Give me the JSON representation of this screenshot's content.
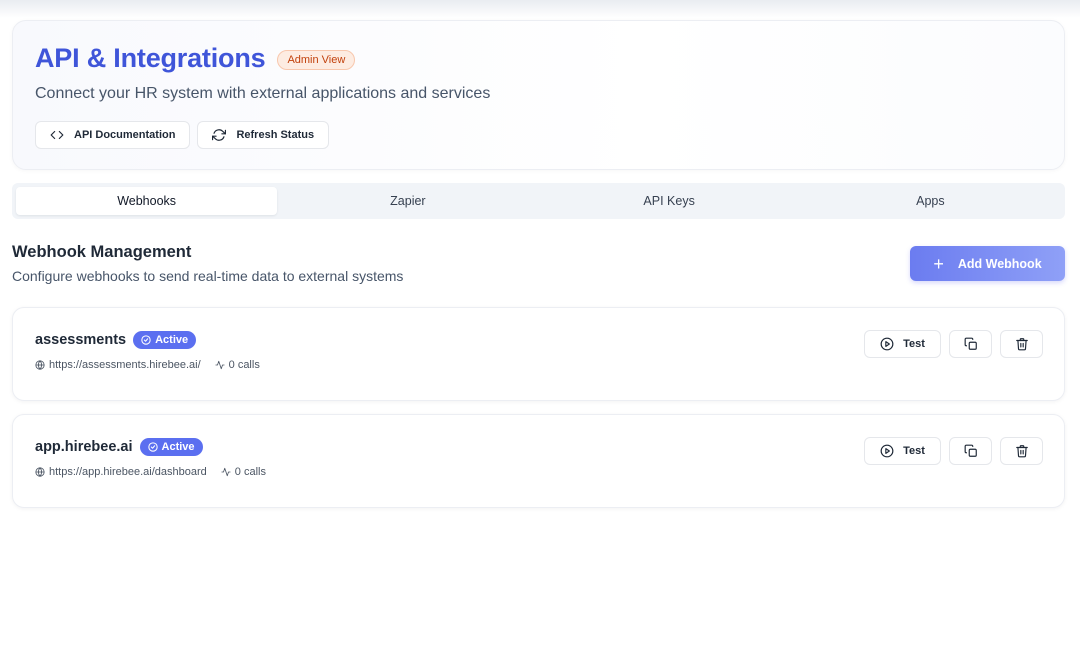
{
  "header": {
    "title": "API & Integrations",
    "badge": "Admin View",
    "subtitle": "Connect your HR system with external applications and services",
    "actions": [
      {
        "label": "API Documentation",
        "icon": "code-icon"
      },
      {
        "label": "Refresh Status",
        "icon": "refresh-icon"
      }
    ]
  },
  "tabs": [
    {
      "label": "Webhooks",
      "active": true
    },
    {
      "label": "Zapier",
      "active": false
    },
    {
      "label": "API Keys",
      "active": false
    },
    {
      "label": "Apps",
      "active": false
    }
  ],
  "section": {
    "title": "Webhook Management",
    "subtitle": "Configure webhooks to send real-time data to external systems",
    "add_button": "Add Webhook"
  },
  "webhooks": [
    {
      "name": "assessments",
      "status": "Active",
      "url": "https://assessments.hirebee.ai/",
      "calls": "0 calls",
      "test_label": "Test"
    },
    {
      "name": "app.hirebee.ai",
      "status": "Active",
      "url": "https://app.hirebee.ai/dashboard",
      "calls": "0 calls",
      "test_label": "Test"
    }
  ],
  "colors": {
    "accent": "#3f55d9",
    "badge_active": "#5b6ff0",
    "admin_badge_text": "#c2410c",
    "admin_badge_bg": "#fdece2"
  }
}
